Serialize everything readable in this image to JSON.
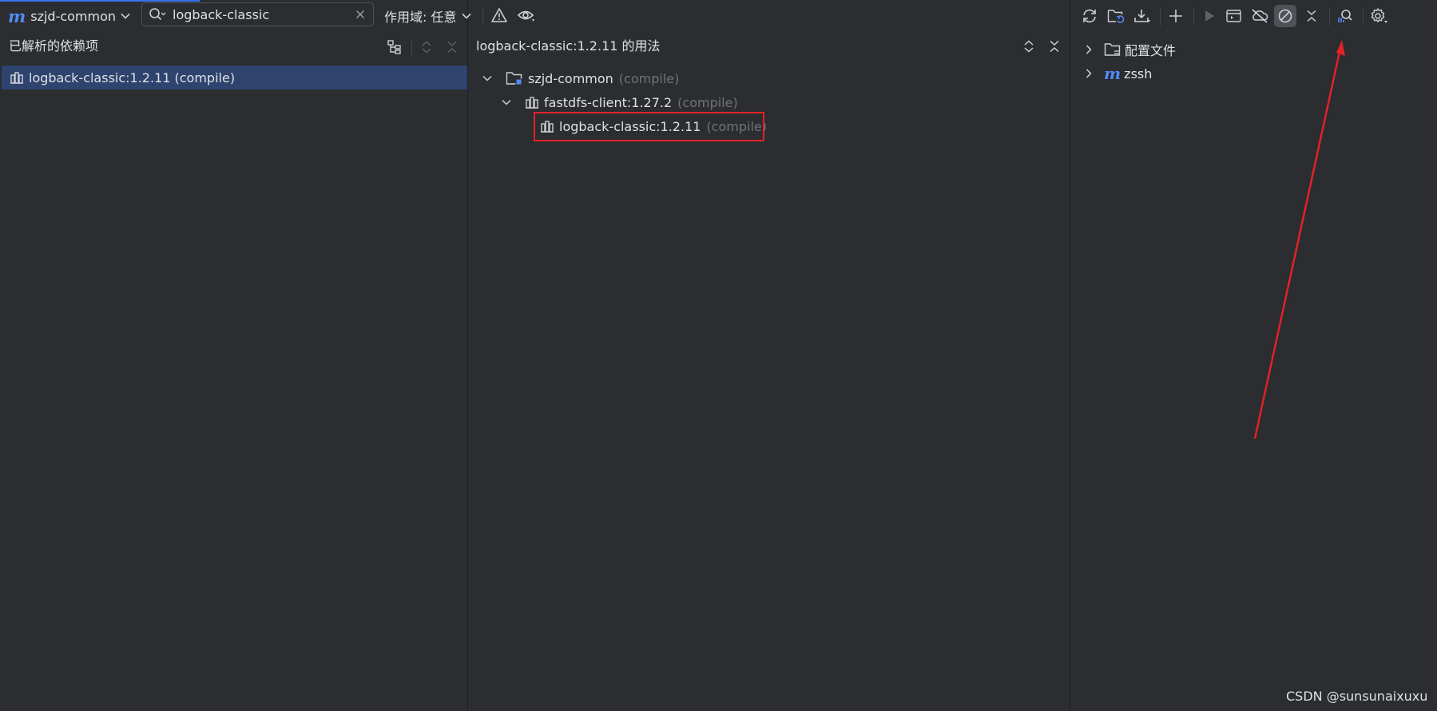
{
  "toolbar": {
    "project_name": "szjd-common",
    "search_value": "logback-classic",
    "scope_label": "作用域: 任意"
  },
  "left_panel": {
    "title": "已解析的依赖项",
    "items": [
      {
        "label": "logback-classic:1.2.11 (compile)"
      }
    ]
  },
  "usage_panel": {
    "title": "logback-classic:1.2.11 的用法",
    "tree": [
      {
        "label": "szjd-common",
        "scope": "(compile)"
      },
      {
        "label": "fastdfs-client:1.27.2",
        "scope": "(compile)"
      },
      {
        "label": "logback-classic:1.2.11",
        "scope": "(compile)"
      }
    ]
  },
  "maven_panel": {
    "items": [
      {
        "label": "配置文件",
        "icon": "folder-icon"
      },
      {
        "label": "zssh",
        "icon": "maven-module-icon"
      }
    ]
  },
  "watermark": "CSDN @sunsunaixuxu",
  "colors": {
    "background": "#2b2d30",
    "selection": "#2e436e",
    "highlight_box": "#e0222a",
    "arrow": "#e0222a",
    "maven_accent": "#548af7"
  }
}
